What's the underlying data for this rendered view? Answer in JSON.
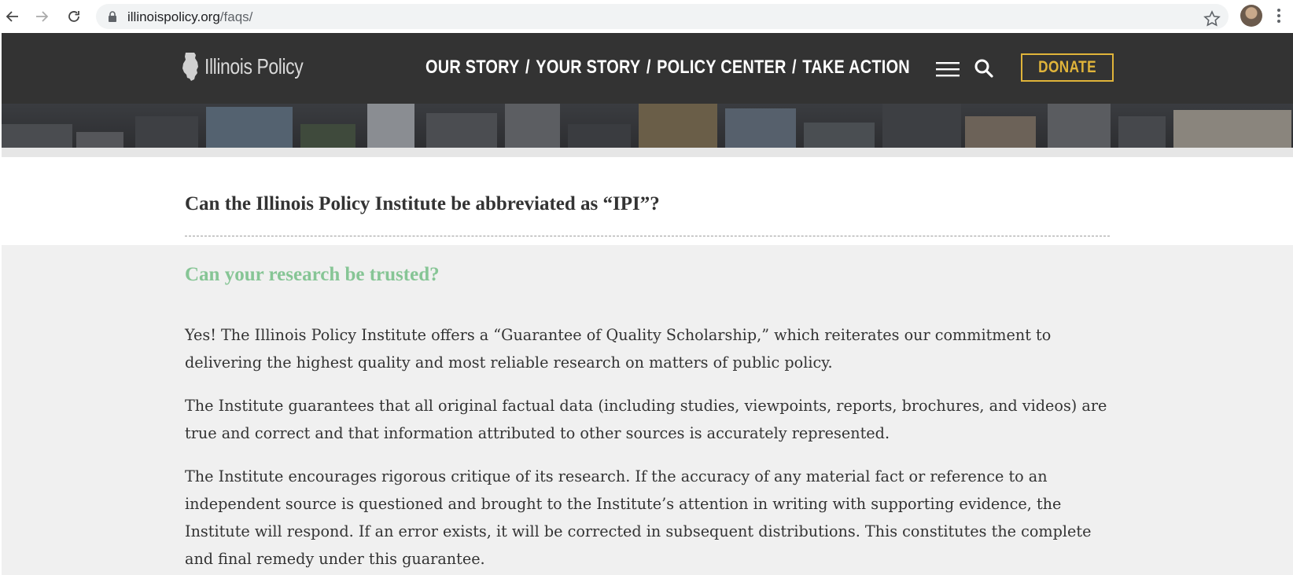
{
  "browser": {
    "url_domain": "illinoispolicy.org",
    "url_path": "/faqs/",
    "icons": [
      "back-arrow-icon",
      "forward-arrow-icon",
      "reload-icon",
      "lock-icon",
      "bookmark-star-icon",
      "profile-avatar",
      "browser-menu-icon"
    ]
  },
  "header": {
    "logo_text": "Illinois Policy",
    "nav": [
      {
        "label": "OUR STORY"
      },
      {
        "label": "YOUR STORY"
      },
      {
        "label": "POLICY CENTER"
      },
      {
        "label": "TAKE ACTION"
      }
    ],
    "separator": "/",
    "donate_label": "DONATE",
    "colors": {
      "background": "#333333",
      "donate": "#e0b43a"
    }
  },
  "faq": {
    "previous_question": "Can the Illinois Policy Institute be abbreviated as “IPI”?",
    "current_question": "Can your research be trusted?",
    "answer_paragraphs": [
      "Yes! The Illinois Policy Institute offers a “Guarantee of Quality Scholarship,” which reiterates our commitment to delivering the highest quality and most reliable research on matters of public policy.",
      "The Institute guarantees that all original factual data (including studies, viewpoints, reports, brochures, and videos) are true and correct and that information attributed to other sources is accurately represented.",
      "The Institute encourages rigorous critique of its research. If the accuracy of any material fact or reference to an independent source is questioned and brought to the Institute’s attention in writing with supporting evidence, the Institute will respond. If an error exists, it will be corrected in subsequent distributions. This constitutes the complete and final remedy under this guarantee."
    ],
    "colors": {
      "active_question": "#86c595",
      "text": "#333333",
      "panel": "#f0f0f0"
    }
  }
}
